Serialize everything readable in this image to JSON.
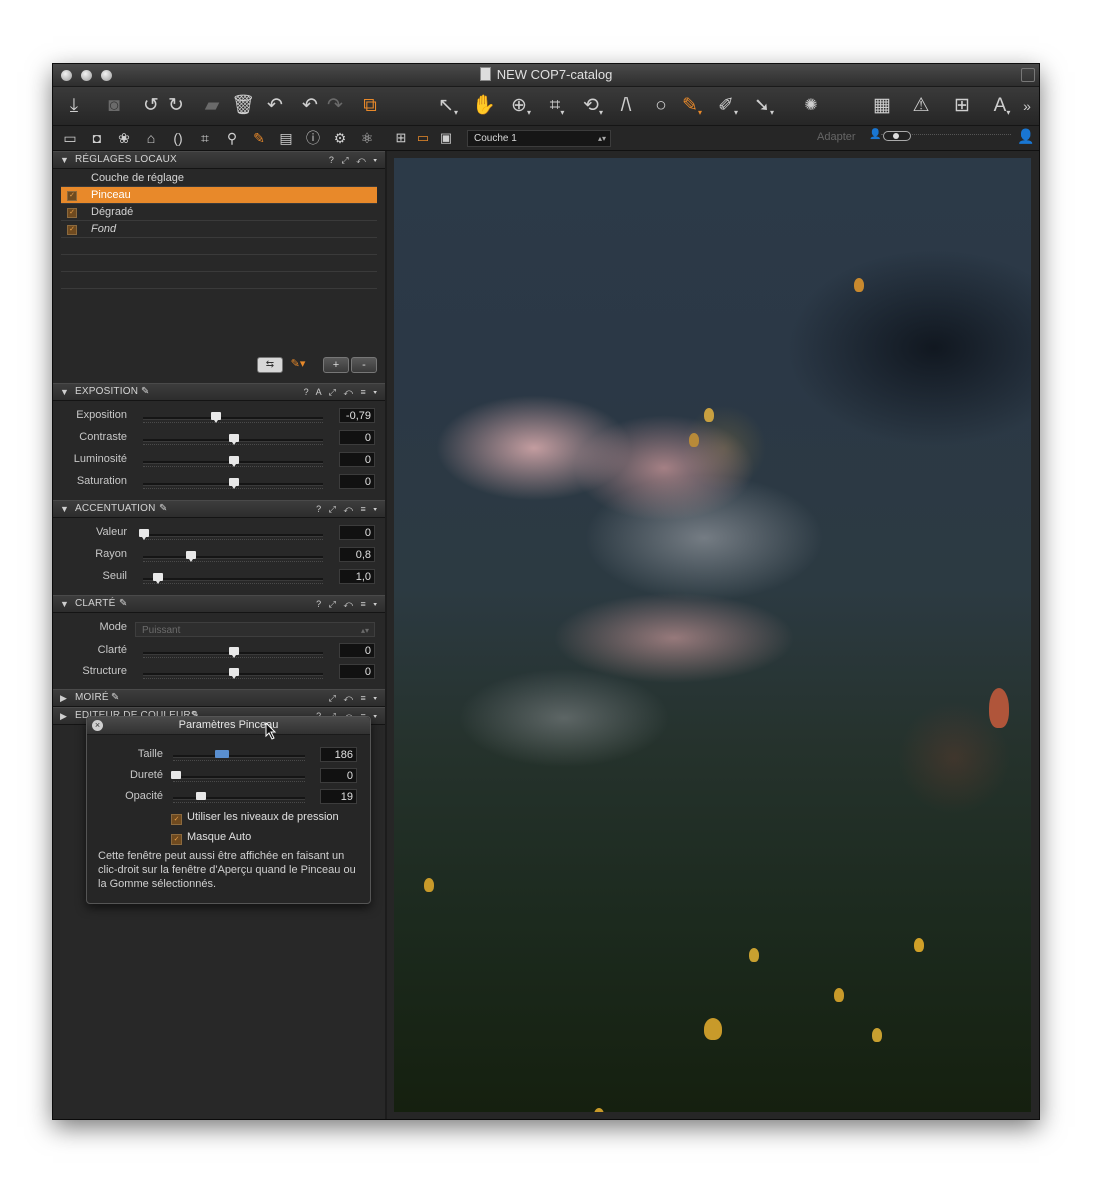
{
  "window": {
    "title": "NEW COP7-catalog"
  },
  "toolbar": {
    "import_icon": "download-icon",
    "tools": [
      "import-icon",
      "camera-icon",
      "rotate-left-icon",
      "rotate-right-icon",
      "folder-icon",
      "trash-icon",
      "undo-history-icon",
      "undo-icon",
      "redo-icon",
      "variants-icon",
      "select-cursor-icon",
      "pan-hand-icon",
      "zoom-icon",
      "crop-icon",
      "rotate-icon",
      "keystone-icon",
      "circle-icon",
      "brush-icon",
      "eraser-icon",
      "picker-icon",
      "spinner-icon",
      "grid-layout-icon",
      "warning-icon",
      "grid-overlay-icon",
      "text-icon",
      "more-icon"
    ]
  },
  "viewer_bar": {
    "layer_select_value": "Couche 1",
    "adapter_label": "Adapter"
  },
  "sections": {
    "local_adjustments": {
      "title": "RÉGLAGES LOCAUX",
      "header_label": "Couche de réglage",
      "layers": [
        {
          "name": "Pinceau",
          "selected": true,
          "italic": false
        },
        {
          "name": "Dégradé",
          "selected": false,
          "italic": false
        },
        {
          "name": "Fond",
          "selected": false,
          "italic": true
        }
      ],
      "add_label": "+",
      "remove_label": "-"
    },
    "exposure": {
      "title": "EXPOSITION",
      "rows": [
        {
          "label": "Exposition",
          "value": "-0,79",
          "position": 0.4
        },
        {
          "label": "Contraste",
          "value": "0",
          "position": 0.5
        },
        {
          "label": "Luminosité",
          "value": "0",
          "position": 0.5
        },
        {
          "label": "Saturation",
          "value": "0",
          "position": 0.5
        }
      ]
    },
    "sharpening": {
      "title": "ACCENTUATION",
      "rows": [
        {
          "label": "Valeur",
          "value": "0",
          "position": 0.0
        },
        {
          "label": "Rayon",
          "value": "0,8",
          "position": 0.26
        },
        {
          "label": "Seuil",
          "value": "1,0",
          "position": 0.08
        }
      ]
    },
    "clarity": {
      "title": "CLARTÉ",
      "mode_label": "Mode",
      "mode_value": "Puissant",
      "rows": [
        {
          "label": "Clarté",
          "value": "0",
          "position": 0.5
        },
        {
          "label": "Structure",
          "value": "0",
          "position": 0.5
        }
      ]
    },
    "moire": {
      "title": "MOIRÉ"
    },
    "color_editor": {
      "title": "EDITEUR DE COULEURS"
    }
  },
  "brush_panel": {
    "title": "Paramètres Pinceau",
    "rows": [
      {
        "label": "Taille",
        "value": "186",
        "position": 0.33
      },
      {
        "label": "Dureté",
        "value": "0",
        "position": 0.0
      },
      {
        "label": "Opacité",
        "value": "19",
        "position": 0.19
      }
    ],
    "checkbox_pressure": "Utiliser les niveaux de pression",
    "checkbox_automask": "Masque Auto",
    "help_text": "Cette fenêtre peut aussi être affichée en faisant un clic-droit sur la fenêtre d'Aperçu quand le Pinceau ou la Gomme sélectionnés."
  },
  "colors": {
    "accent": "#e8892a",
    "panel": "#282828",
    "titlebar": "#3a3a3a"
  }
}
